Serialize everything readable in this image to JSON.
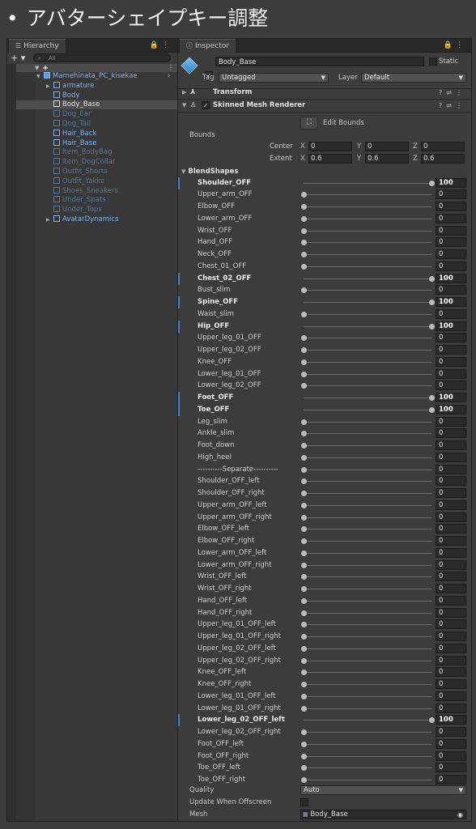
{
  "title": {
    "bullet": "•",
    "text": "アバターシェイプキー調整"
  },
  "hierarchy": {
    "tab_label": "Hierarchy",
    "search_placeholder": "All",
    "items": [
      {
        "label": "Mamehinata_PC_kisekae",
        "style": "blue"
      },
      {
        "label": "armature",
        "style": "blue"
      },
      {
        "label": "Body",
        "style": "blue"
      },
      {
        "label": "Body_Base",
        "style": "white"
      },
      {
        "label": "Dog_Ear",
        "style": "dim"
      },
      {
        "label": "Dog_Tail",
        "style": "dim"
      },
      {
        "label": "Hair_Back",
        "style": "blue"
      },
      {
        "label": "Hair_Base",
        "style": "blue"
      },
      {
        "label": "Item_BodyBag",
        "style": "dim"
      },
      {
        "label": "Item_DogCollar",
        "style": "dim"
      },
      {
        "label": "Outfit_Shorts",
        "style": "dim"
      },
      {
        "label": "Outfit_Yakke",
        "style": "dim"
      },
      {
        "label": "Shoes_Sneakers",
        "style": "dim"
      },
      {
        "label": "Under_Spats",
        "style": "dim"
      },
      {
        "label": "Under_Tops",
        "style": "dim"
      },
      {
        "label": "AvatarDynamics",
        "style": "blue"
      }
    ]
  },
  "inspector": {
    "tab_label": "Inspector",
    "object_name": "Body_Base",
    "static_label": "Static",
    "tag_label": "Tag",
    "tag_value": "Untagged",
    "layer_label": "Layer",
    "layer_value": "Default",
    "transform_label": "Transform",
    "smr_label": "Skinned Mesh Renderer",
    "edit_bounds_label": "Edit Bounds",
    "bounds_label": "Bounds",
    "center_label": "Center",
    "extent_label": "Extent",
    "center": {
      "x": "0",
      "y": "0",
      "z": "0"
    },
    "extent": {
      "x": "0.6",
      "y": "0.6",
      "z": "0.6"
    },
    "blendshapes_label": "BlendShapes",
    "blendshapes": [
      {
        "name": "Shoulder_OFF",
        "value": 100
      },
      {
        "name": "Upper_arm_OFF",
        "value": 0
      },
      {
        "name": "Elbow_OFF",
        "value": 0
      },
      {
        "name": "Lower_arm_OFF",
        "value": 0
      },
      {
        "name": "Wrist_OFF",
        "value": 0
      },
      {
        "name": "Hand_OFF",
        "value": 0
      },
      {
        "name": "Neck_OFF",
        "value": 0
      },
      {
        "name": "Chest_01_OFF",
        "value": 0
      },
      {
        "name": "Chest_02_OFF",
        "value": 100
      },
      {
        "name": "Bust_slim",
        "value": 0
      },
      {
        "name": "Spine_OFF",
        "value": 100
      },
      {
        "name": "Waist_slim",
        "value": 0
      },
      {
        "name": "Hip_OFF",
        "value": 100
      },
      {
        "name": "Upper_leg_01_OFF",
        "value": 0
      },
      {
        "name": "Upper_leg_02_OFF",
        "value": 0
      },
      {
        "name": "Knee_OFF",
        "value": 0
      },
      {
        "name": "Lower_leg_01_OFF",
        "value": 0
      },
      {
        "name": "Lower_leg_02_OFF",
        "value": 0
      },
      {
        "name": "Foot_OFF",
        "value": 100
      },
      {
        "name": "Toe_OFF",
        "value": 100
      },
      {
        "name": "Leg_slim",
        "value": 0
      },
      {
        "name": "Ankle_slim",
        "value": 0
      },
      {
        "name": "Foot_down",
        "value": 0
      },
      {
        "name": "High_heel",
        "value": 0
      },
      {
        "name": "----------Separate----------",
        "value": 0
      },
      {
        "name": "Shoulder_OFF_left",
        "value": 0
      },
      {
        "name": "Shoulder_OFF_right",
        "value": 0
      },
      {
        "name": "Upper_arm_OFF_left",
        "value": 0
      },
      {
        "name": "Upper_arm_OFF_right",
        "value": 0
      },
      {
        "name": "Elbow_OFF_left",
        "value": 0
      },
      {
        "name": "Elbow_OFF_right",
        "value": 0
      },
      {
        "name": "Lower_arm_OFF_left",
        "value": 0
      },
      {
        "name": "Lower_arm_OFF_right",
        "value": 0
      },
      {
        "name": "Wrist_OFF_left",
        "value": 0
      },
      {
        "name": "Wrist_OFF_right",
        "value": 0
      },
      {
        "name": "Hand_OFF_left",
        "value": 0
      },
      {
        "name": "Hand_OFF_right",
        "value": 0
      },
      {
        "name": "Upper_leg_01_OFF_left",
        "value": 0
      },
      {
        "name": "Upper_leg_01_OFF_right",
        "value": 0
      },
      {
        "name": "Upper_leg_02_OFF_left",
        "value": 0
      },
      {
        "name": "Upper_leg_02_OFF_right",
        "value": 0
      },
      {
        "name": "Knee_OFF_left",
        "value": 0
      },
      {
        "name": "Knee_OFF_right",
        "value": 0
      },
      {
        "name": "Lower_leg_01_OFF_left",
        "value": 0
      },
      {
        "name": "Lower_leg_01_OFF_right",
        "value": 0
      },
      {
        "name": "Lower_leg_02_OFF_left",
        "value": 100
      },
      {
        "name": "Lower_leg_02_OFF_right",
        "value": 0
      },
      {
        "name": "Foot_OFF_left",
        "value": 0
      },
      {
        "name": "Foot_OFF_right",
        "value": 0
      },
      {
        "name": "Toe_OFF_left",
        "value": 0
      },
      {
        "name": "Toe_OFF_right",
        "value": 0
      }
    ],
    "quality_label": "Quality",
    "quality_value": "Auto",
    "update_offscreen_label": "Update When Offscreen",
    "mesh_label": "Mesh",
    "mesh_value": "Body_Base"
  }
}
